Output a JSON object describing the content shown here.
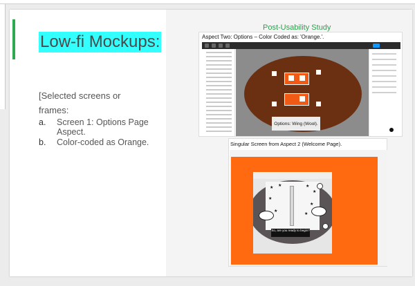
{
  "slide": {
    "title": "Low-fi Mockups:",
    "post_usability_title": "Post-Usability Study",
    "body_paragraph_1": "[Selected screens or",
    "body_paragraph_2": "frames:",
    "list": [
      {
        "marker": "a.",
        "text": "Screen 1: Options Page Aspect."
      },
      {
        "marker": "b.",
        "text": "Color-coded as Orange."
      }
    ]
  },
  "screenshot_1": {
    "caption": "Aspect Two: Options – Color Coded as: 'Orange.'.",
    "tooltip": "Options: Wing (Wool)."
  },
  "screenshot_2": {
    "caption": "Singular Screen from Aspect 2 (Welcome Page).",
    "speech": "So, are you ready to begin?"
  },
  "colors": {
    "accent_green": "#2fa84f",
    "title_highlight": "#33ffff",
    "orange": "#ff6a10",
    "brown": "#6b2f12"
  }
}
